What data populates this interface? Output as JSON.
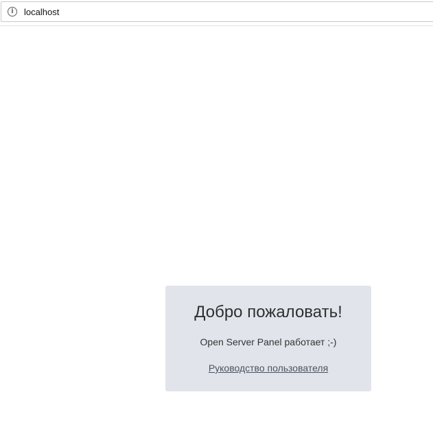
{
  "browser": {
    "address": "localhost",
    "address_icon": "info-icon"
  },
  "card": {
    "title": "Добро пожаловать!",
    "status": "Open Server Panel работает ;-)",
    "guide_link": "Руководство пользователя",
    "background": "#e1e5eb"
  }
}
